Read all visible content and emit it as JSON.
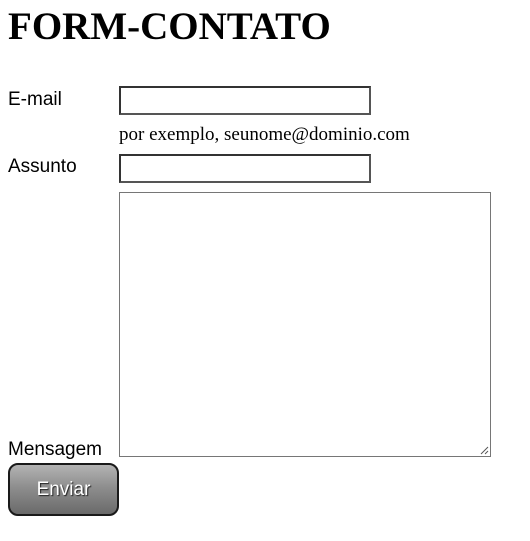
{
  "page": {
    "title": "FORM-CONTATO"
  },
  "form": {
    "email": {
      "label": "E-mail",
      "value": "",
      "hint": "por exemplo, seunome@dominio.com"
    },
    "subject": {
      "label": "Assunto",
      "value": ""
    },
    "message": {
      "label": "Mensagem",
      "value": ""
    },
    "submit": {
      "label": "Enviar"
    }
  },
  "colors": {
    "background": "#ffffff",
    "text": "#000000",
    "button_gradient_top": "#b3b3b3",
    "button_gradient_bottom": "#6a6a6a",
    "button_text": "#ffffff"
  }
}
